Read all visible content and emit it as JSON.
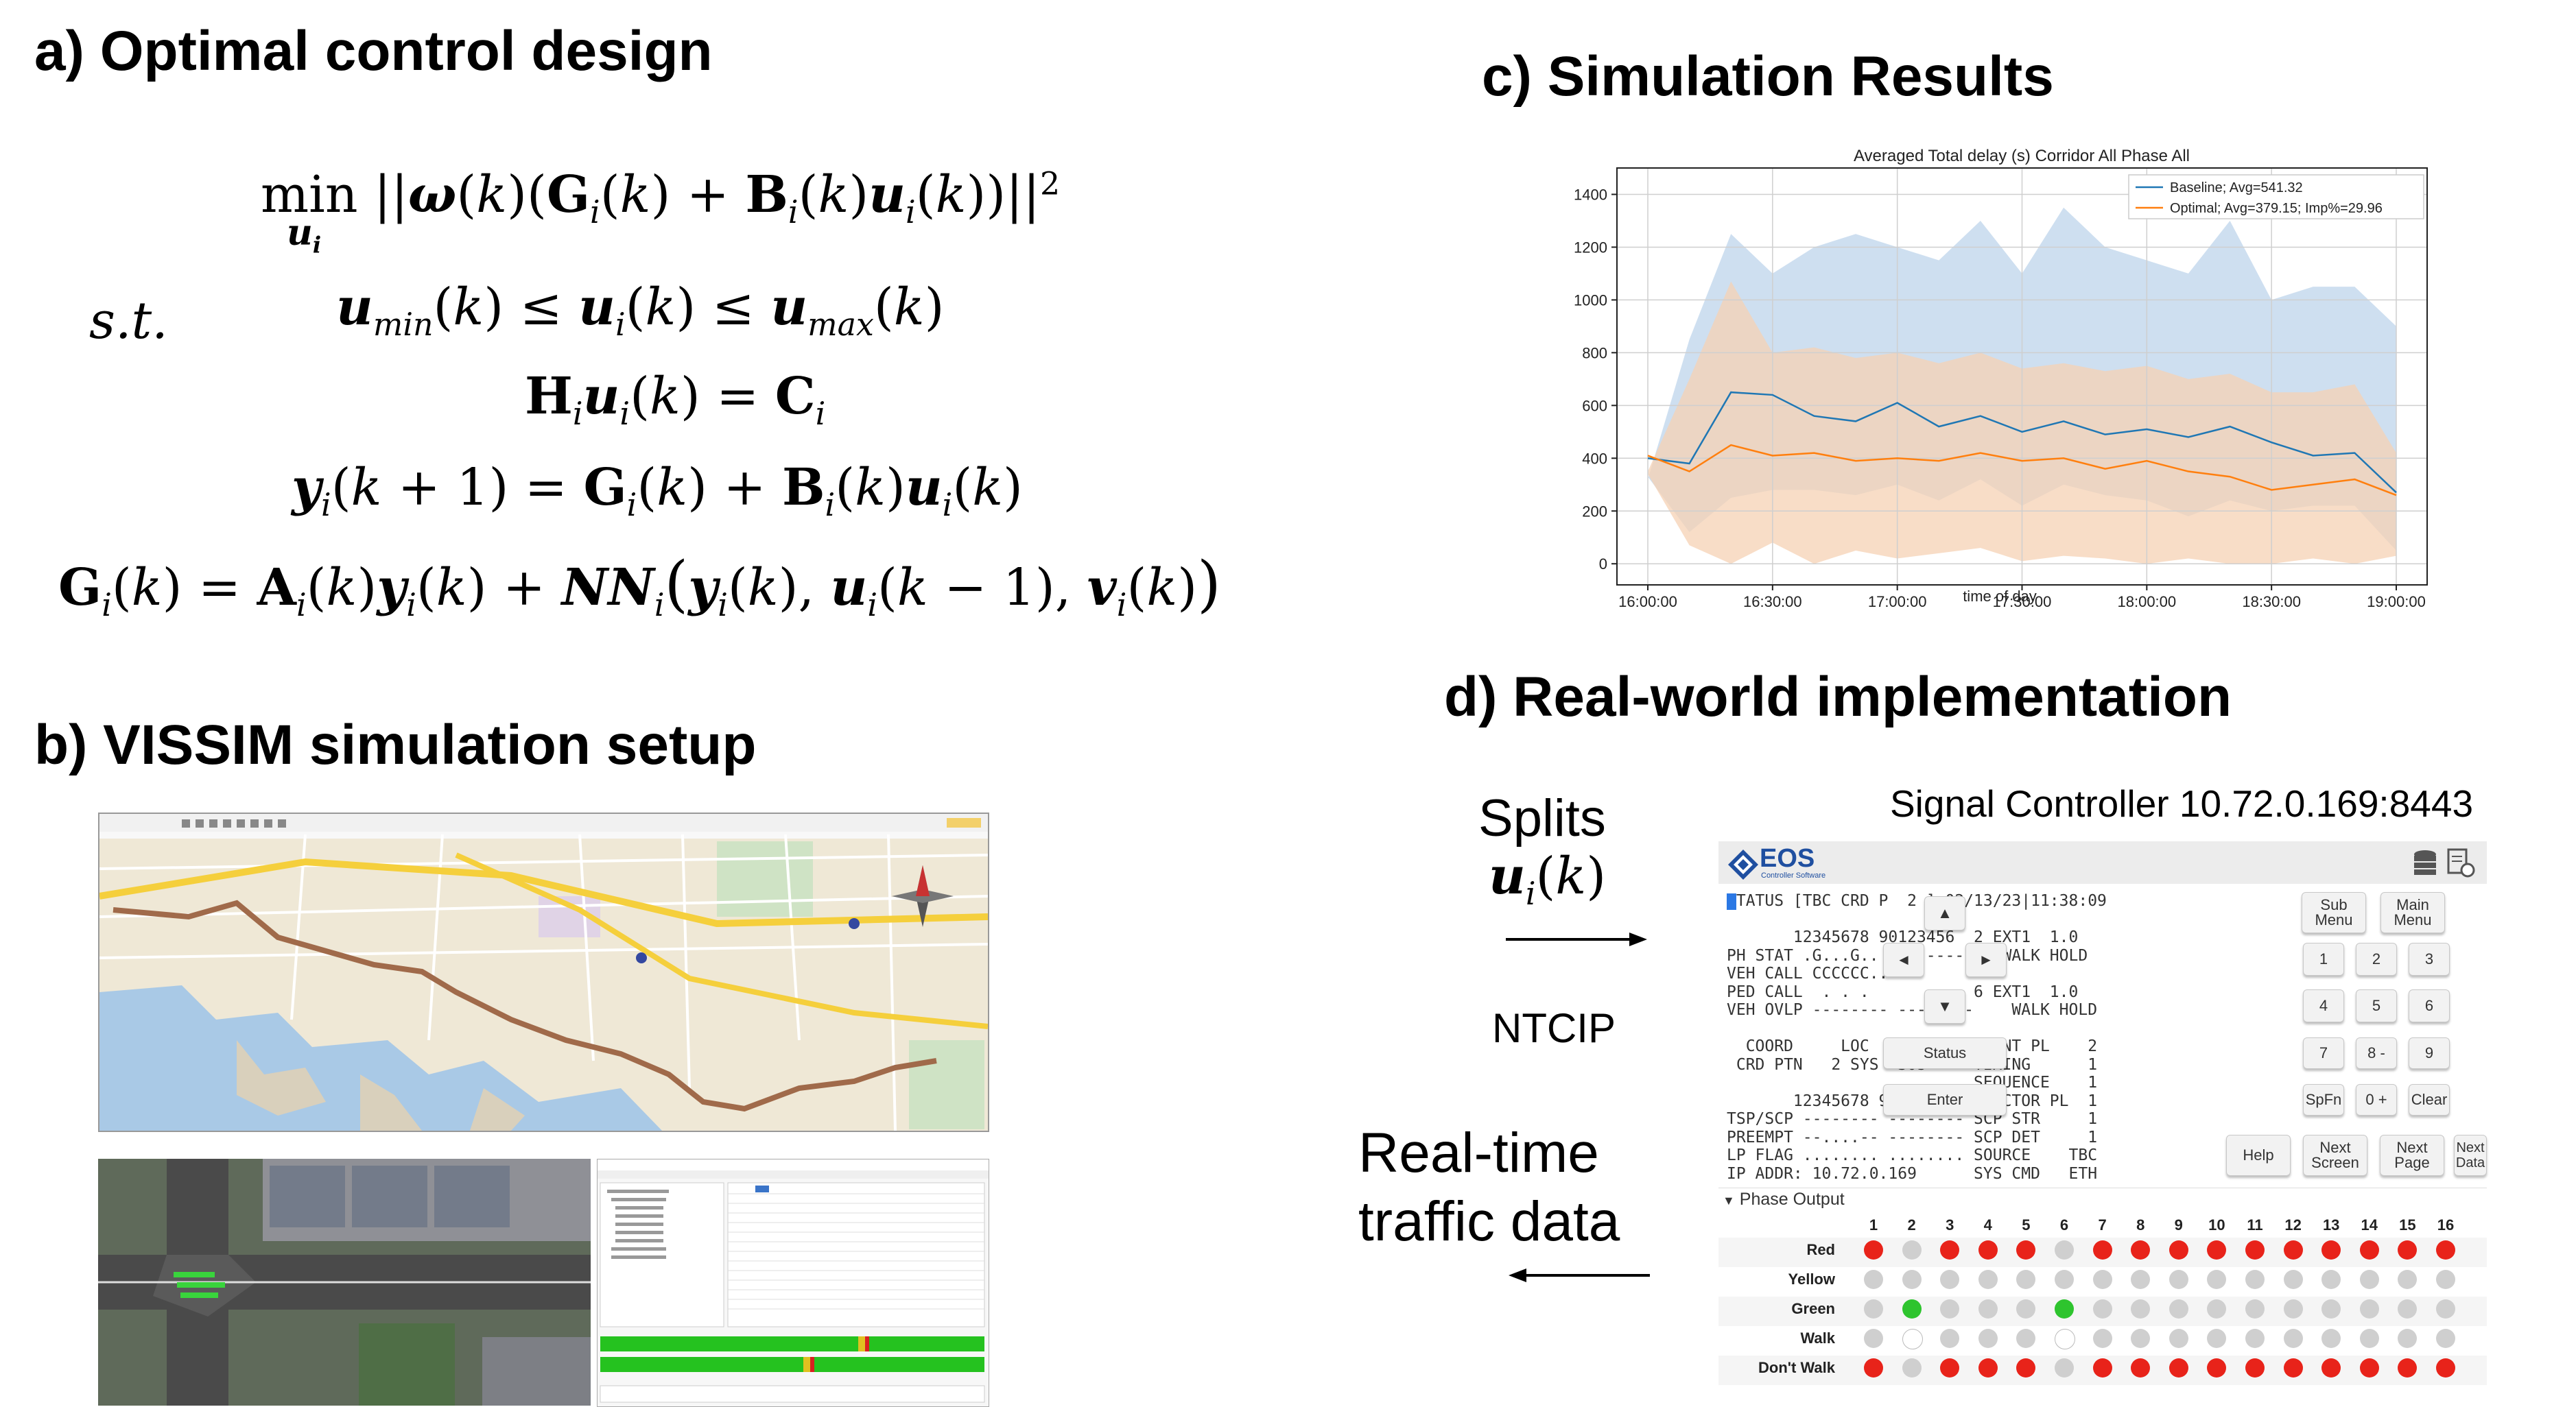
{
  "headings": {
    "a": "a) Optimal control design",
    "b": "b) VISSIM simulation setup",
    "c": "c) Simulation Results",
    "d": "d) Real-world implementation"
  },
  "equations": {
    "min_word": "min",
    "st": "s.t."
  },
  "chart_data": {
    "type": "line",
    "title": "Averaged Total delay (s) Corridor All Phase All",
    "xlabel": "time of day",
    "ylabel": "",
    "x_range": [
      "16:00:00",
      "19:00:00"
    ],
    "ylim": [
      -80,
      1500
    ],
    "x_ticks": [
      "16:00:00",
      "16:30:00",
      "17:00:00",
      "17:30:00",
      "18:00:00",
      "18:30:00",
      "19:00:00"
    ],
    "y_ticks": [
      "0",
      "200",
      "400",
      "600",
      "800",
      "1000",
      "1200",
      "1400"
    ],
    "grid": true,
    "legend_position": "top-right",
    "series": [
      {
        "name": "Baseline; Avg=541.32",
        "color": "#1f77b4",
        "band_color": "#c9dcee",
        "minutes": [
          0,
          10,
          20,
          30,
          40,
          50,
          60,
          70,
          80,
          90,
          100,
          110,
          120,
          130,
          140,
          150,
          160,
          170,
          180
        ],
        "values": [
          400,
          380,
          650,
          640,
          560,
          540,
          610,
          520,
          560,
          500,
          540,
          490,
          510,
          480,
          520,
          460,
          410,
          420,
          270
        ],
        "upper": [
          320,
          850,
          1250,
          1100,
          1200,
          1250,
          1200,
          1150,
          1300,
          1100,
          1350,
          1200,
          1150,
          1100,
          1300,
          1000,
          1050,
          1050,
          900
        ],
        "lower": [
          330,
          120,
          250,
          280,
          280,
          260,
          300,
          240,
          320,
          220,
          300,
          260,
          240,
          180,
          240,
          200,
          220,
          220,
          50
        ]
      },
      {
        "name": "Optimal; Avg=379.15; Imp%=29.96",
        "color": "#ff7f0e",
        "band_color": "#f6d2b4",
        "minutes": [
          0,
          10,
          20,
          30,
          40,
          50,
          60,
          70,
          80,
          90,
          100,
          110,
          120,
          130,
          140,
          150,
          160,
          170,
          180
        ],
        "values": [
          410,
          350,
          450,
          410,
          420,
          390,
          400,
          390,
          420,
          390,
          400,
          360,
          390,
          350,
          330,
          280,
          300,
          320,
          260
        ],
        "upper": [
          350,
          700,
          1070,
          800,
          820,
          780,
          800,
          760,
          800,
          740,
          760,
          730,
          750,
          700,
          720,
          650,
          650,
          680,
          420
        ],
        "lower": [
          340,
          70,
          0,
          80,
          0,
          50,
          20,
          40,
          60,
          10,
          30,
          20,
          0,
          20,
          0,
          0,
          20,
          0,
          30
        ]
      }
    ]
  },
  "implementation": {
    "splits_label": "Splits",
    "ntcip_label": "NTCIP",
    "realtime_line1": "Real-time",
    "realtime_line2": "traffic data",
    "controller_title": "Signal Controller 10.72.0.169:8443",
    "logo_text": "EOS",
    "logo_sub": "Controller Software",
    "terminal_lines": [
      "STATUS [TBC CRD P  2 ] 02/13/23|11:38:09",
      "",
      "       12345678 90123456  2 EXT1  1.0",
      "PH STAT .G...G.. --------    WALK HOLD",
      "VEH CALL CCCCCC..",
      "PED CALL  . . .           6 EXT1  1.0",
      "VEH OVLP -------- --------    WALK HOLD",
      "",
      "  COORD     LOC  28s/160  EVENT PL    2",
      " CRD PTN   2 SYS  30s     TIMING      1",
      "                          SEQUENCE    1",
      "       12345678 90123456 DETECTOR PL  1",
      "TSP/SCP -------- -------- SCP STR     1",
      "PREEMPT --....-- -------- SCP DET     1",
      "LP FLAG ........ ........ SOURCE    TBC",
      "IP ADDR: 10.72.0.169      SYS CMD   ETH"
    ],
    "keypad": {
      "up": "▲",
      "left": "◄",
      "right": "►",
      "down": "▼",
      "sub_menu": "Sub Menu",
      "main_menu": "Main Menu",
      "status": "Status",
      "enter": "Enter",
      "spfn": "SpFn",
      "k1": "1",
      "k2": "2",
      "k3": "3",
      "k4": "4",
      "k5": "5",
      "k6": "6",
      "k7": "7",
      "k8": "8 -",
      "k9": "9",
      "k0": "0 +",
      "clear": "Clear",
      "help": "Help",
      "next_screen": "Next Screen",
      "next_page": "Next Page",
      "next_data": "Next Data"
    },
    "phase_output_label": "Phase Output",
    "phase_numbers": [
      "1",
      "2",
      "3",
      "4",
      "5",
      "6",
      "7",
      "8",
      "9",
      "10",
      "11",
      "12",
      "13",
      "14",
      "15",
      "16"
    ],
    "phase_rows": [
      {
        "label": "Red",
        "states": [
          "r",
          "g",
          "r",
          "r",
          "r",
          "g",
          "r",
          "r",
          "r",
          "r",
          "r",
          "r",
          "r",
          "r",
          "r",
          "r"
        ]
      },
      {
        "label": "Yellow",
        "states": [
          "g",
          "g",
          "g",
          "g",
          "g",
          "g",
          "g",
          "g",
          "g",
          "g",
          "g",
          "g",
          "g",
          "g",
          "g",
          "g"
        ]
      },
      {
        "label": "Green",
        "states": [
          "g",
          "G",
          "g",
          "g",
          "g",
          "G",
          "g",
          "g",
          "g",
          "g",
          "g",
          "g",
          "g",
          "g",
          "g",
          "g"
        ]
      },
      {
        "label": "Walk",
        "states": [
          "g",
          "w",
          "g",
          "g",
          "g",
          "w",
          "g",
          "g",
          "g",
          "g",
          "g",
          "g",
          "g",
          "g",
          "g",
          "g"
        ]
      },
      {
        "label": "Don't Walk",
        "states": [
          "r",
          "g",
          "r",
          "r",
          "r",
          "g",
          "r",
          "r",
          "r",
          "r",
          "r",
          "r",
          "r",
          "r",
          "r",
          "r"
        ]
      }
    ],
    "colors": {
      "red": "#e8231a",
      "green": "#2ec42e",
      "gray": "#cfcfcf",
      "walk": "#ffffff"
    }
  }
}
